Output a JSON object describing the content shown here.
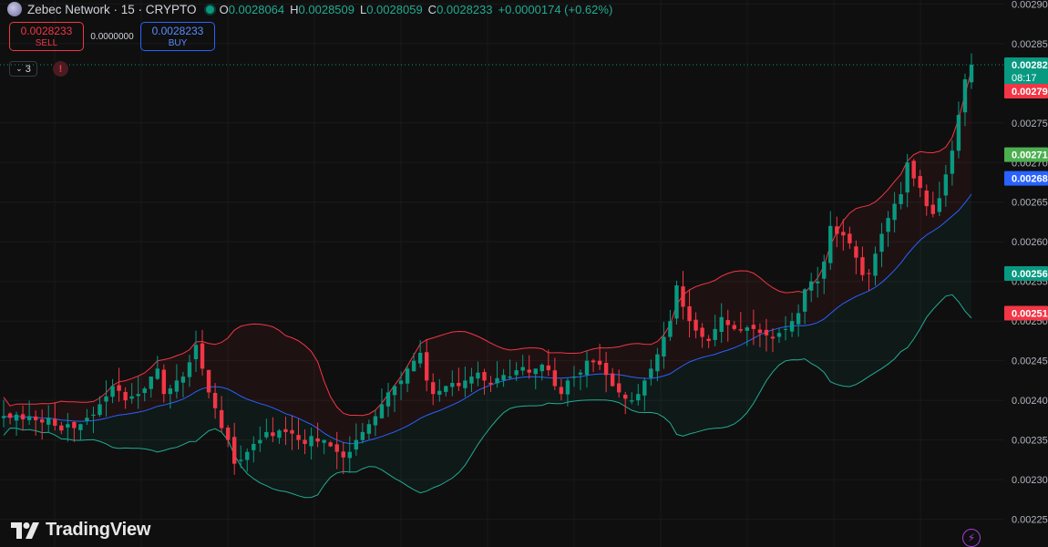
{
  "header": {
    "symbol_title": "Zebec Network · 15 · CRYPTO",
    "o_label": "O",
    "o_value": "0.0028064",
    "h_label": "H",
    "h_value": "0.0028509",
    "l_label": "L",
    "l_value": "0.0028059",
    "c_label": "C",
    "c_value": "0.0028233",
    "change": "+0.0000174 (+0.62%)"
  },
  "trade": {
    "sell_price": "0.0028233",
    "sell_label": "SELL",
    "spread": "0.0000000",
    "buy_price": "0.0028233",
    "buy_label": "BUY"
  },
  "indicator_count": "3",
  "logo_text": "TradingView",
  "colors": {
    "background": "#0f0f0f",
    "up": "#089981",
    "down": "#f23645",
    "middle_band": "#2962ff",
    "upper_band": "#f23645",
    "lower_band": "#22ab94"
  },
  "chart_data": {
    "type": "candlestick",
    "ylim": [
      0.002215,
      0.002905
    ],
    "ytick_labels": [
      "0.00290",
      "0.00285",
      "0.00275",
      "0.00270",
      "0.00265",
      "0.00260",
      "0.00255",
      "0.00250",
      "0.00245",
      "0.00240",
      "0.00235",
      "0.00230",
      "0.00225"
    ],
    "price_tags": [
      {
        "text": "0.00282",
        "sub": "08:17",
        "value": 0.0028233,
        "color": "#089981"
      },
      {
        "text": "0.00279",
        "value": 0.00279,
        "color": "#f23645"
      },
      {
        "text": "0.00271",
        "value": 0.00271,
        "color": "#4caf50"
      },
      {
        "text": "0.00268",
        "value": 0.00268,
        "color": "#2962ff"
      },
      {
        "text": "0.00256",
        "value": 0.00256,
        "color": "#089981"
      },
      {
        "text": "0.00251",
        "value": 0.00251,
        "color": "#f23645"
      }
    ],
    "close_series": [
      0.00238,
      0.002378,
      0.002382,
      0.002376,
      0.00238,
      0.002375,
      0.002372,
      0.002378,
      0.002368,
      0.002362,
      0.00237,
      0.002365,
      0.00237,
      0.002378,
      0.002382,
      0.002395,
      0.002405,
      0.002418,
      0.002412,
      0.0024,
      0.002405,
      0.002408,
      0.002415,
      0.00243,
      0.00244,
      0.002408,
      0.002415,
      0.002425,
      0.00243,
      0.002448,
      0.00247,
      0.00244,
      0.00241,
      0.00239,
      0.002365,
      0.00235,
      0.00232,
      0.002325,
      0.002335,
      0.002345,
      0.00235,
      0.00236,
      0.002355,
      0.002362,
      0.00236,
      0.002358,
      0.00235,
      0.002345,
      0.002355,
      0.002348,
      0.00235,
      0.002342,
      0.002335,
      0.002328,
      0.002335,
      0.00235,
      0.00236,
      0.00237,
      0.00238,
      0.002395,
      0.00241,
      0.002418,
      0.002425,
      0.00244,
      0.00245,
      0.00246,
      0.002425,
      0.002408,
      0.002412,
      0.002418,
      0.002422,
      0.002418,
      0.002425,
      0.00243,
      0.002435,
      0.002425,
      0.00242,
      0.002428,
      0.002432,
      0.00243,
      0.002438,
      0.002442,
      0.002435,
      0.00244,
      0.002445,
      0.002438,
      0.002418,
      0.002408,
      0.002425,
      0.00243,
      0.002435,
      0.00245,
      0.002448,
      0.002445,
      0.002432,
      0.002418,
      0.00241,
      0.002402,
      0.0024,
      0.002408,
      0.002425,
      0.00244,
      0.002458,
      0.00248,
      0.0025,
      0.002545,
      0.002518,
      0.0025,
      0.002488,
      0.00248,
      0.002475,
      0.00249,
      0.002505,
      0.002495,
      0.00249,
      0.002488,
      0.002492,
      0.00249,
      0.002485,
      0.002482,
      0.002478,
      0.002485,
      0.00249,
      0.0025,
      0.00251,
      0.00254,
      0.00255,
      0.00255,
      0.002575,
      0.00262,
      0.00261,
      0.002608,
      0.002598,
      0.00258,
      0.002558,
      0.00256,
      0.002585,
      0.00261,
      0.00263,
      0.002648,
      0.00266,
      0.0027,
      0.00268,
      0.002668,
      0.002645,
      0.002635,
      0.002655,
      0.002685,
      0.002715,
      0.00276,
      0.002805,
      0.0028233
    ]
  }
}
